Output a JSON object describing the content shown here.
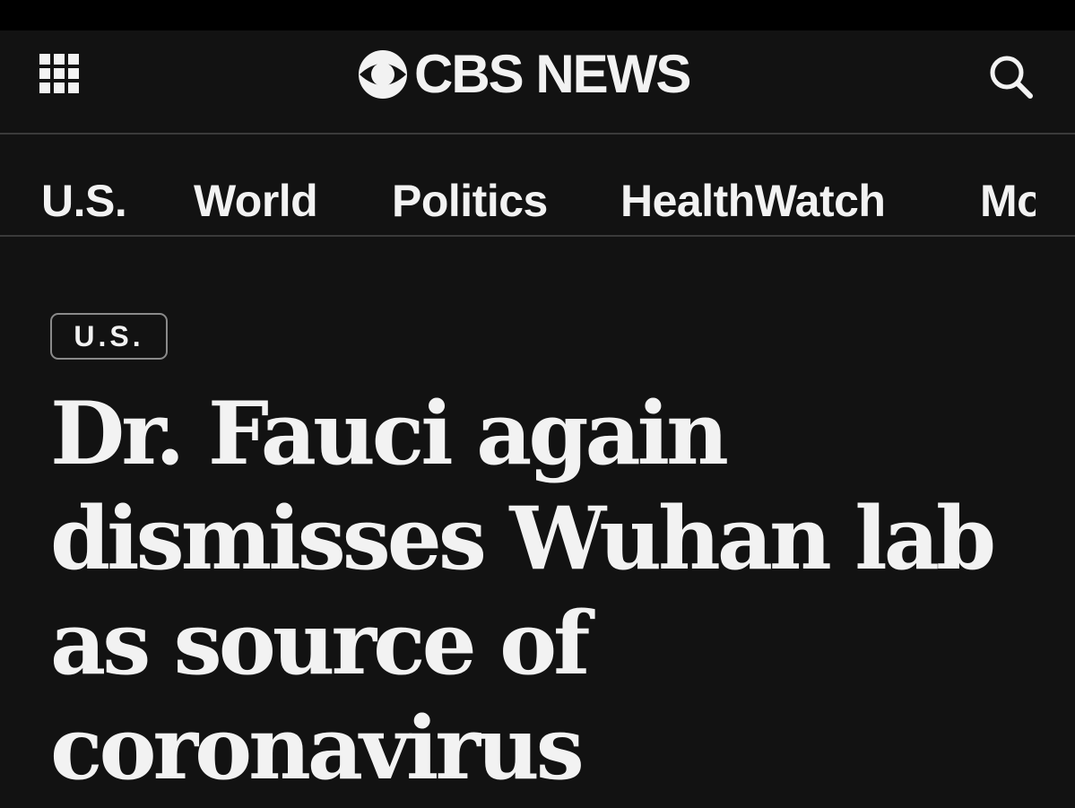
{
  "header": {
    "logo_text": "CBS NEWS",
    "menu_icon": "grid-menu-icon",
    "search_icon": "search-icon"
  },
  "nav": {
    "items": [
      {
        "label": "U.S."
      },
      {
        "label": "World"
      },
      {
        "label": "Politics"
      },
      {
        "label": "HealthWatch"
      },
      {
        "label": "Mo"
      }
    ]
  },
  "article": {
    "category_tag": "U.S.",
    "headline_lines": [
      "Dr. Fauci again",
      "dismisses Wuhan lab",
      "as source of",
      "coronavirus"
    ]
  },
  "colors": {
    "background": "#121212",
    "top_strip": "#000000",
    "text": "#f2f2f2",
    "divider": "#3a3a3a",
    "tag_border": "#8a8a8a"
  }
}
